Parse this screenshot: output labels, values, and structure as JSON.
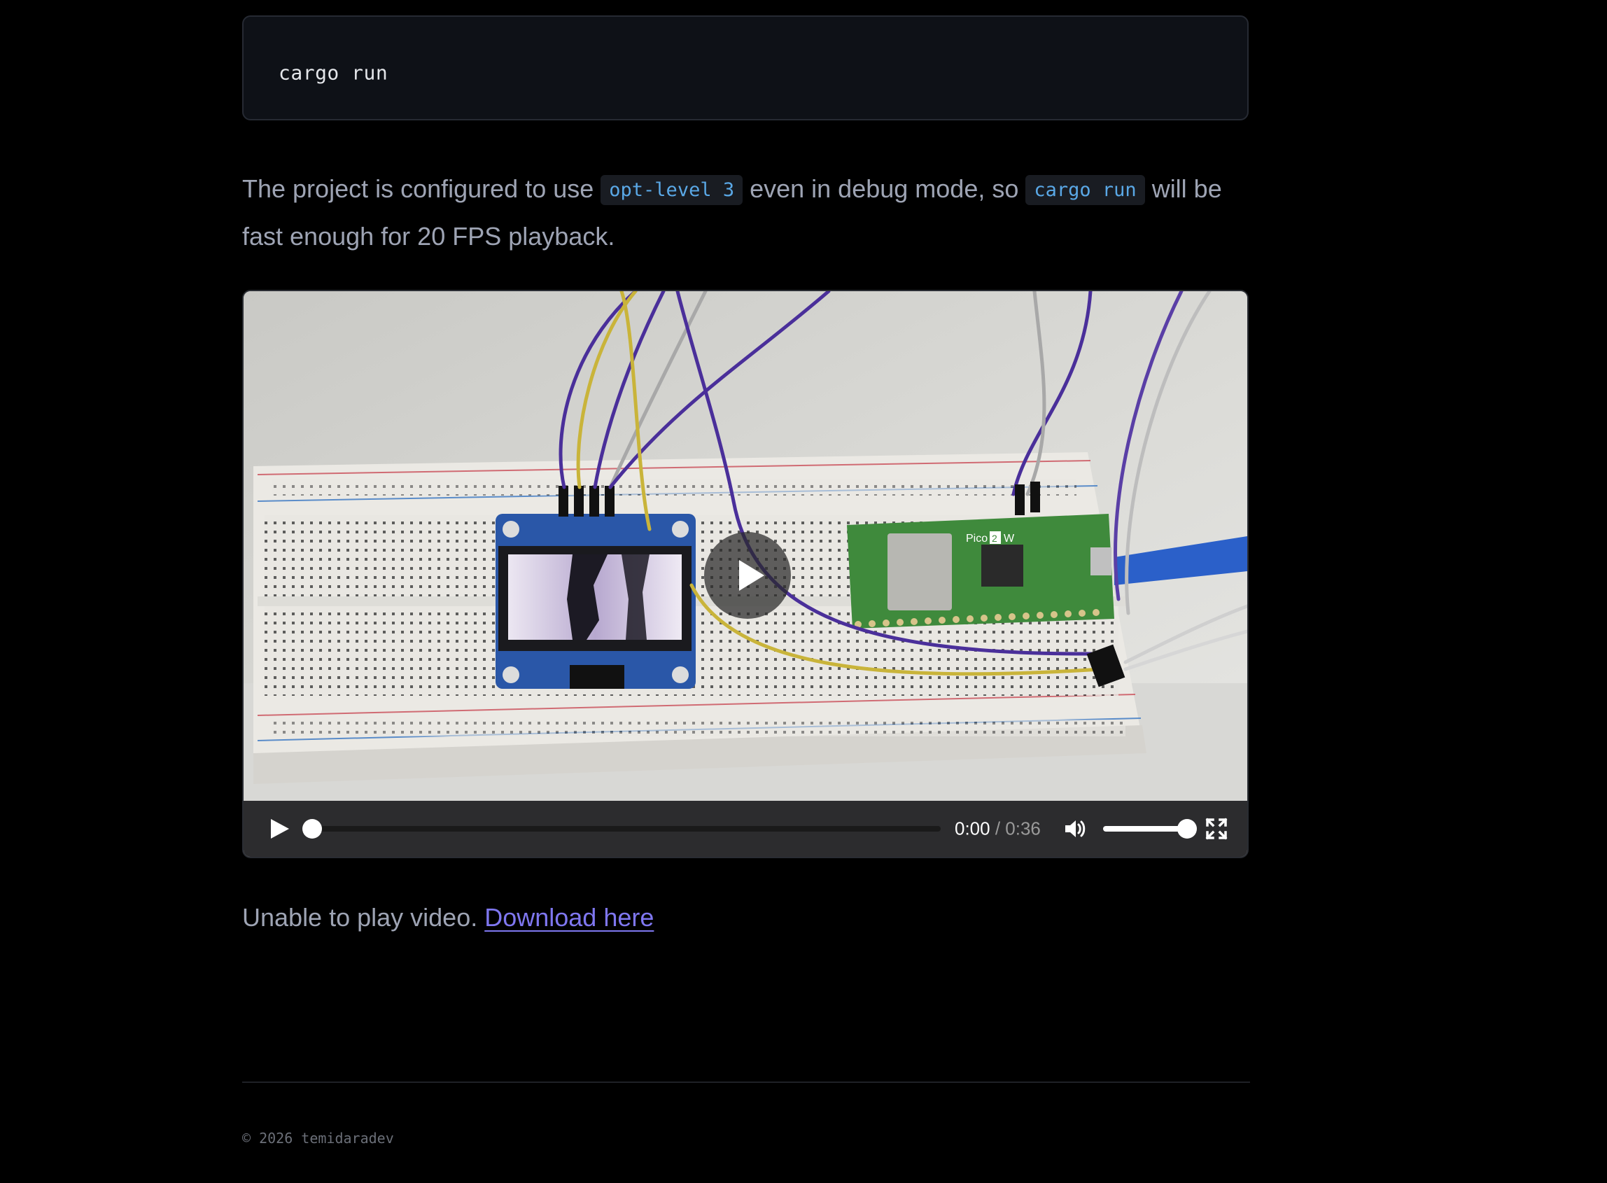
{
  "code_block": {
    "command": "cargo run"
  },
  "paragraph": {
    "text_1": "The project is configured to use ",
    "code_1": "opt-level 3",
    "text_2": " even in debug mode, so ",
    "code_2": "cargo run",
    "text_3": " will be fast enough for 20 FPS playback."
  },
  "video_player": {
    "current_time": "0:00",
    "separator": " / ",
    "duration": "0:36",
    "progress_fraction": 0.0,
    "volume_fraction": 1.0,
    "board_label": "Pico",
    "board_label_badge": "2",
    "board_label_suffix": "W",
    "icons": {
      "big_play": "play-icon",
      "play": "play-icon",
      "volume": "volume-icon",
      "fullscreen": "fullscreen-icon"
    }
  },
  "fallback": {
    "text": "Unable to play video. ",
    "link_label": "Download here"
  },
  "footer": {
    "copyright": "© 2026 temidaradev"
  },
  "colors": {
    "background": "#000000",
    "code_block_bg": "#0e1117",
    "inline_code_text": "#5aa8e6",
    "link": "#7f77f0",
    "body_text": "#9ea4b4"
  }
}
